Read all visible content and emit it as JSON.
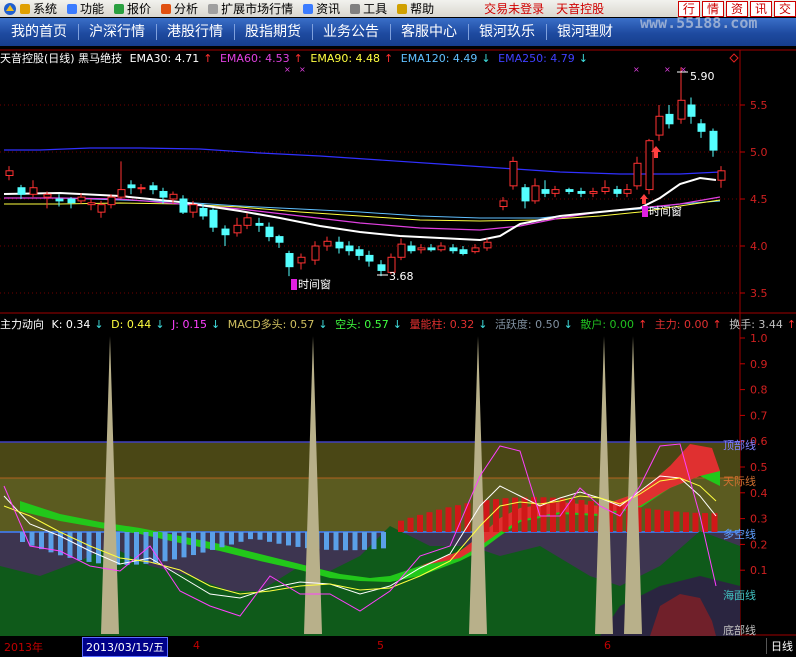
{
  "menu": {
    "items": [
      {
        "label": "系统",
        "color": "#e0a000"
      },
      {
        "label": "功能",
        "color": "#3b7cff"
      },
      {
        "label": "报价",
        "color": "#2aa040"
      },
      {
        "label": "分析",
        "color": "#e05010"
      },
      {
        "label": "扩展市场行情",
        "color": "#a0a0a0"
      },
      {
        "label": "资讯",
        "color": "#3b7cff"
      },
      {
        "label": "工具",
        "color": "#808080"
      },
      {
        "label": "帮助",
        "color": "#d0a000"
      }
    ],
    "promo1": "交易未登录",
    "promo2": "天音控股",
    "buttons": [
      "行",
      "情",
      "资",
      "讯",
      "交"
    ],
    "site": "www.55188.com"
  },
  "nav": {
    "items": [
      "我的首页",
      "沪深行情",
      "港股行情",
      "股指期货",
      "业务公告",
      "客服中心",
      "银河玖乐",
      "银河理财"
    ]
  },
  "main_legend": {
    "title": "天音控股(日线) 黑马绝技",
    "ema30": "EMA30: 4.71",
    "ema60": "EMA60: 4.53",
    "ema90": "EMA90: 4.48",
    "ema120": "EMA120: 4.49",
    "ema250": "EMA250: 4.79",
    "colors": {
      "ema30": "#ffffff",
      "ema60": "#e040e0",
      "ema90": "#ffff40",
      "ema120": "#60c0ff",
      "ema250": "#4040ff"
    }
  },
  "ind_legend": {
    "title": "主力动向",
    "k": "K: 0.34",
    "d": "D: 0.44",
    "j": "J: 0.15",
    "macd": "MACD多头: 0.57",
    "kongtou": "空头: 0.57",
    "nengliang": "量能柱: 0.32",
    "huoyue": "活跃度: 0.50",
    "sanhu": "散户: 0.00",
    "zhuli": "主力: 0.00",
    "huanshou": "换手: 3.44"
  },
  "price_axis": [
    "5.5",
    "5.0",
    "4.5",
    "4.0",
    "3.5"
  ],
  "ind_axis": [
    "1.0",
    "0.9",
    "0.8",
    "0.7",
    "0.6",
    "0.5",
    "0.4",
    "0.3",
    "0.2",
    "0.1"
  ],
  "ind_zone_labels": [
    "顶部线",
    "天际线",
    "多空线",
    "海面线",
    "底部线"
  ],
  "annotations": {
    "high": "5.90",
    "low": "3.68",
    "window1": "时间窗",
    "window2": "时间窗"
  },
  "datebar": {
    "year": "2013年",
    "current": "2013/03/15/五",
    "months": [
      "4",
      "5",
      "6"
    ],
    "period": "日线"
  }
}
